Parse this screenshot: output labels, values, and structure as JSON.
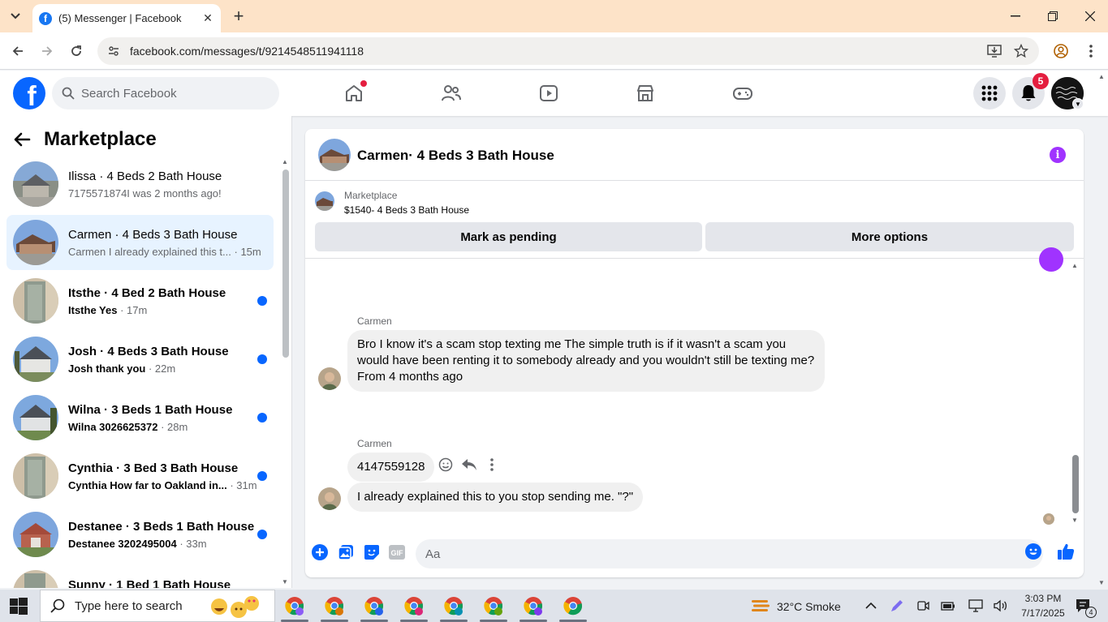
{
  "browser": {
    "tab_title": "(5) Messenger | Facebook",
    "url": "facebook.com/messages/t/9214548511941118"
  },
  "fb_header": {
    "search_placeholder": "Search Facebook",
    "notification_count": "5"
  },
  "sidebar": {
    "title": "Marketplace",
    "conversations": [
      {
        "name": "Ilissa · 4 Beds 2 Bath House",
        "preview": "7175571874I was 2 months ago!",
        "time": "",
        "unread": false,
        "active": false
      },
      {
        "name": "Carmen · 4 Beds 3 Bath House",
        "preview": "Carmen I already explained this t...",
        "time": " · 15m",
        "unread": false,
        "active": true
      },
      {
        "name": "Itsthe · 4 Bed 2 Bath House",
        "preview": "Itsthe Yes",
        "time": " · 17m",
        "unread": true,
        "active": false
      },
      {
        "name": "Josh · 4 Beds 3 Bath House",
        "preview": "Josh thank you",
        "time": " · 22m",
        "unread": true,
        "active": false
      },
      {
        "name": "Wilna · 3 Beds 1 Bath House",
        "preview": "Wilna 3026625372",
        "time": " · 28m",
        "unread": true,
        "active": false
      },
      {
        "name": "Cynthia · 3 Bed 3 Bath House",
        "preview": "Cynthia How far to Oakland in...",
        "time": " · 31m",
        "unread": true,
        "active": false
      },
      {
        "name": "Destanee · 3 Beds 1 Bath House",
        "preview": "Destanee 3202495004",
        "time": " · 33m",
        "unread": true,
        "active": false
      },
      {
        "name": "Sunny · 1 Bed 1 Bath House",
        "preview": "",
        "time": "",
        "unread": true,
        "active": false
      }
    ]
  },
  "chat": {
    "title": "Carmen· 4 Beds 3 Bath House",
    "listing_source": "Marketplace",
    "listing_title": "$1540- 4 Beds 3 Bath House",
    "mark_pending_label": "Mark as pending",
    "more_options_label": "More options",
    "messages": [
      {
        "sender": "Carmen",
        "text": "Bro I know it's a scam stop texting me The simple truth is if it wasn't a scam you would have been renting it to somebody already and you wouldn't still be texting me? From 4 months ago"
      },
      {
        "sender": "Carmen",
        "text": "4147559128"
      },
      {
        "sender": "",
        "text": "I already explained this to you stop sending me. \"?\""
      }
    ],
    "composer_placeholder": "Aa"
  },
  "taskbar": {
    "search_placeholder": "Type here to search",
    "weather": "32°C  Smoke",
    "time": "3:03 PM",
    "date": "7/17/2025",
    "notification_count": "4"
  },
  "colors": {
    "fb_blue": "#0866ff",
    "unread_dot": "#0866ff",
    "info_purple": "#a033ff",
    "badge_red": "#e41e3f",
    "active_bg": "#e7f3ff"
  }
}
